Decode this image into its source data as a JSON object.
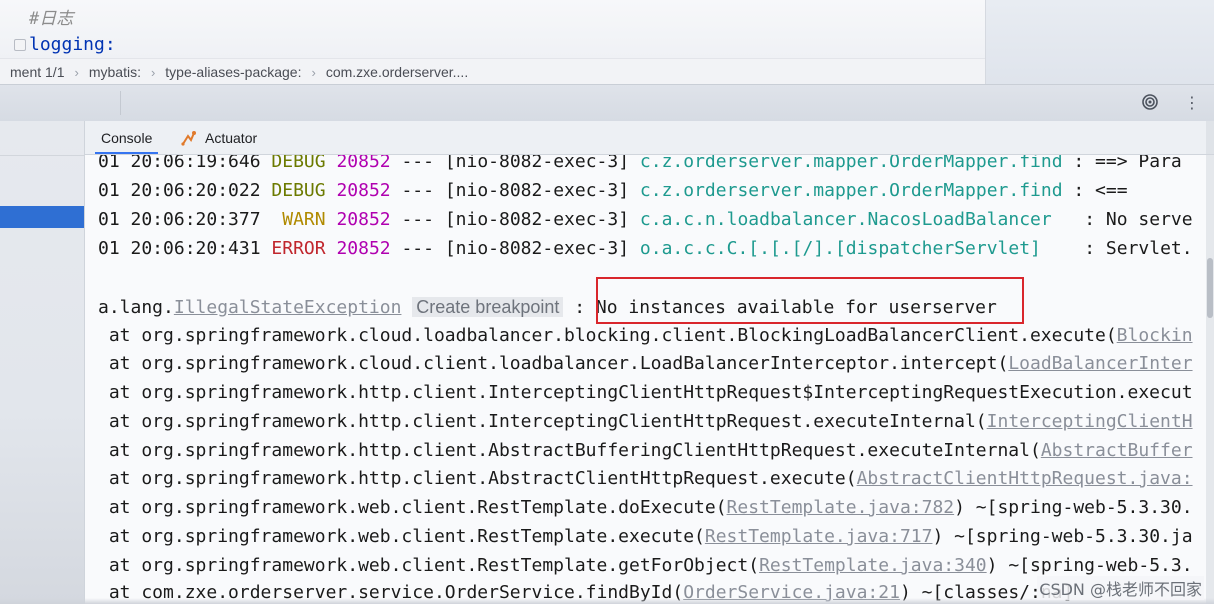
{
  "editor": {
    "comment": "#日志",
    "key": "logging:"
  },
  "breadcrumb": [
    "ment 1/1",
    "mybatis:",
    "type-aliases-package:",
    "com.zxe.orderserver...."
  ],
  "breadcrumb_separator": "›",
  "toolwindow": {
    "more_icon": "⋮",
    "tabs": {
      "console": "Console",
      "actuator": "Actuator"
    }
  },
  "icons": {
    "target": "target-icon",
    "more": "more-vertical-icon",
    "actuator": "actuator-icon"
  },
  "logs": [
    {
      "time": "01 20:06:19:646",
      "level": "DEBUG",
      "pid": "20852",
      "sep": "---",
      "thread": "[nio-8082-exec-3]",
      "logger": "c.z.orderserver.mapper.OrderMapper.find",
      "msg": " : ==> Para"
    },
    {
      "time": "01 20:06:20:022",
      "level": "DEBUG",
      "pid": "20852",
      "sep": "---",
      "thread": "[nio-8082-exec-3]",
      "logger": "c.z.orderserver.mapper.OrderMapper.find",
      "msg": " : <=="
    },
    {
      "time": "01 20:06:20:377",
      "level": " WARN",
      "pid": "20852",
      "sep": "---",
      "thread": "[nio-8082-exec-3]",
      "logger": "c.a.c.n.loadbalancer.NacosLoadBalancer  ",
      "msg": " : No serve"
    },
    {
      "time": "01 20:06:20:431",
      "level": "ERROR",
      "pid": "20852",
      "sep": "---",
      "thread": "[nio-8082-exec-3]",
      "logger": "o.a.c.c.C.[.[.[/].[dispatcherServlet]   ",
      "msg": " : Servlet."
    }
  ],
  "exception": {
    "prefix": "a.lang.",
    "class": "IllegalStateException",
    "breakpoint": "Create breakpoint",
    "colon": " : ",
    "message": "No instances available for userserver"
  },
  "stack": [
    {
      "call": " at org.springframework.cloud.loadbalancer.blocking.client.BlockingLoadBalancerClient.execute(",
      "link": "Blockin"
    },
    {
      "call": " at org.springframework.cloud.client.loadbalancer.LoadBalancerInterceptor.intercept(",
      "link": "LoadBalancerInter"
    },
    {
      "call": " at org.springframework.http.client.InterceptingClientHttpRequest$InterceptingRequestExecution.execut",
      "link": ""
    },
    {
      "call": " at org.springframework.http.client.InterceptingClientHttpRequest.executeInternal(",
      "link": "InterceptingClientH"
    },
    {
      "call": " at org.springframework.http.client.AbstractBufferingClientHttpRequest.executeInternal(",
      "link": "AbstractBuffer"
    },
    {
      "call": " at org.springframework.http.client.AbstractClientHttpRequest.execute(",
      "link": "AbstractClientHttpRequest.java:"
    },
    {
      "call": " at org.springframework.web.client.RestTemplate.doExecute(",
      "link": "RestTemplate.java:782",
      "tail": ") ~[spring-web-5.3.30."
    },
    {
      "call": " at org.springframework.web.client.RestTemplate.execute(",
      "link": "RestTemplate.java:717",
      "tail": ") ~[spring-web-5.3.30.ja"
    },
    {
      "call": " at org.springframework.web.client.RestTemplate.getForObject(",
      "link": "RestTemplate.java:340",
      "tail": ") ~[spring-web-5.3."
    },
    {
      "call": " at com.zxe.orderserver.service.OrderService.findById(",
      "link": "OrderService.java:21",
      "tail": ") ~[classes/:na]"
    }
  ],
  "watermark": "CSDN @栈老师不回家"
}
